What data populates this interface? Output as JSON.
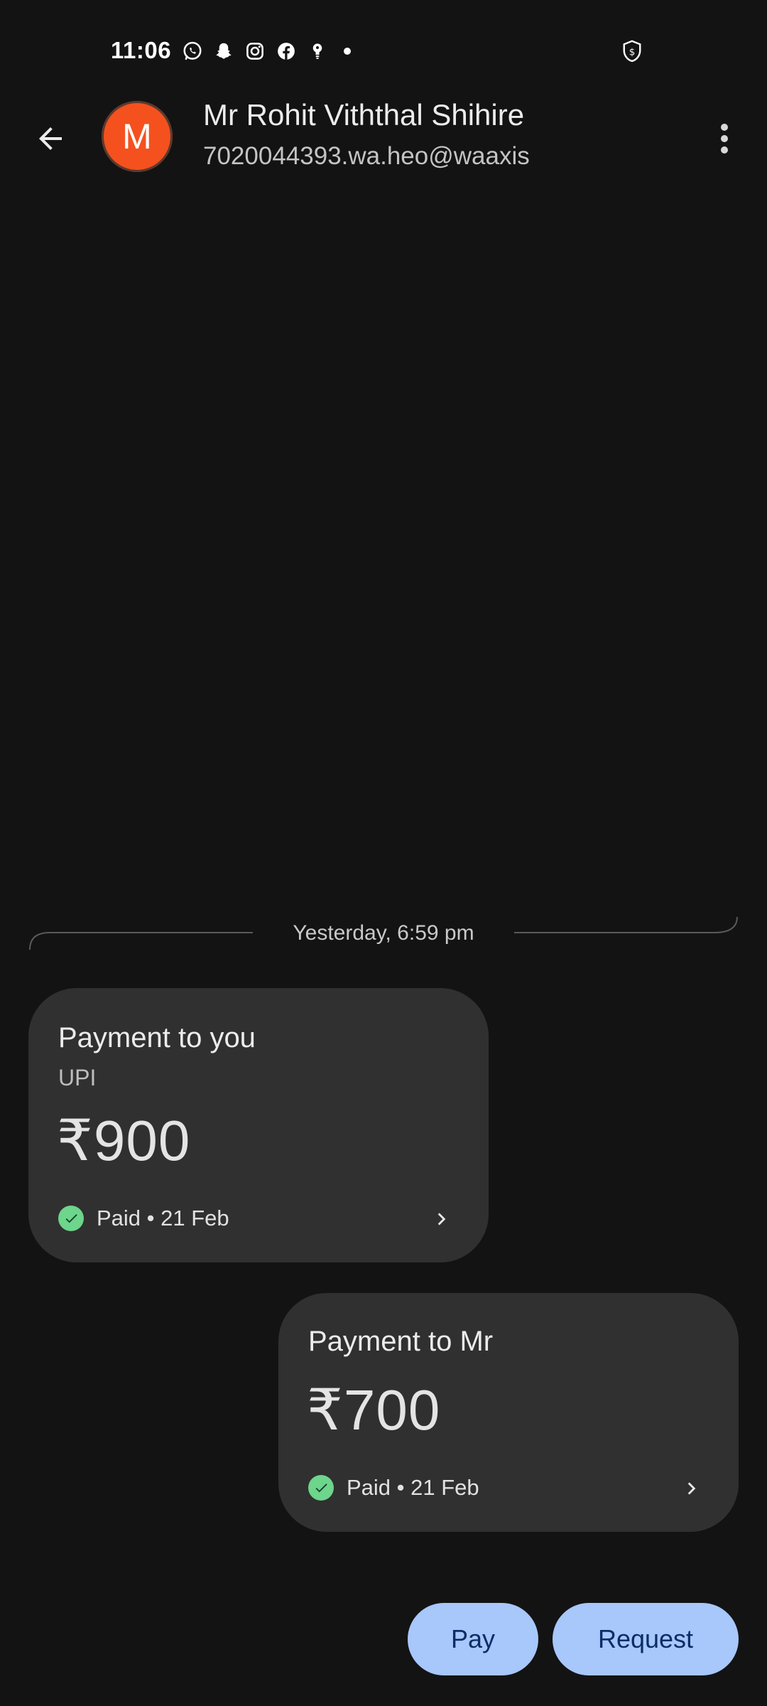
{
  "status_bar": {
    "time": "11:06",
    "notification_icons": [
      "whatsapp-icon",
      "snapchat-icon",
      "instagram-icon",
      "facebook-icon",
      "bulb-icon"
    ],
    "shield_icon": "shield-dollar-icon"
  },
  "header": {
    "avatar_letter": "M",
    "avatar_color": "#f4511e",
    "name": "Mr Rohit Viththal Shihire",
    "upi_id": "7020044393.wa.heo@waaxis"
  },
  "divider": {
    "date_label": "Yesterday, 6:59 pm"
  },
  "payments": [
    {
      "title": "Payment to you",
      "subtitle": "UPI",
      "amount": "₹900",
      "status": "Paid • 21 Feb"
    },
    {
      "title": "Payment to Mr",
      "amount": "₹700",
      "status": "Paid • 21 Feb"
    }
  ],
  "actions": {
    "pay_label": "Pay",
    "request_label": "Request"
  },
  "colors": {
    "background": "#131313",
    "card": "#303030",
    "success": "#6dd58c",
    "button": "#a8c7fa",
    "button_text": "#0b2d66"
  }
}
